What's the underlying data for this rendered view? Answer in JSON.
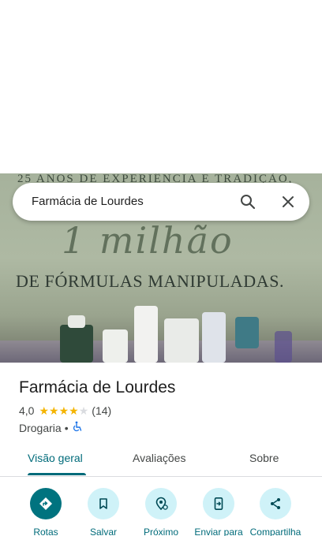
{
  "search": {
    "query": "Farmácia de Lourdes"
  },
  "hero": {
    "wall_top_text": "25 ANOS DE EXPERIÊNCIA E TRADIÇÃO,",
    "script_text": "1 milhão",
    "caps_text": "DE FÓRMULAS MANIPULADAS."
  },
  "place": {
    "name": "Farmácia de Lourdes",
    "rating": "4,0",
    "rating_value": 4.0,
    "stars_max": 5,
    "review_count": "(14)",
    "category": "Drogaria",
    "separator": "•"
  },
  "tabs": [
    {
      "label": "Visão geral",
      "active": true
    },
    {
      "label": "Avaliações",
      "active": false
    },
    {
      "label": "Sobre",
      "active": false
    }
  ],
  "actions": [
    {
      "label": "Rotas",
      "icon": "directions-icon"
    },
    {
      "label": "Salvar",
      "icon": "bookmark-icon"
    },
    {
      "label": "Próximo",
      "icon": "nearby-icon"
    },
    {
      "label": "Enviar para",
      "icon": "send-to-phone-icon"
    },
    {
      "label": "Compartilha",
      "icon": "share-icon"
    }
  ],
  "colors": {
    "accent": "#006b7a",
    "action_primary": "#00737f",
    "action_secondary": "#cff2f8",
    "star": "#f4b400",
    "star_empty": "#dadce0"
  }
}
